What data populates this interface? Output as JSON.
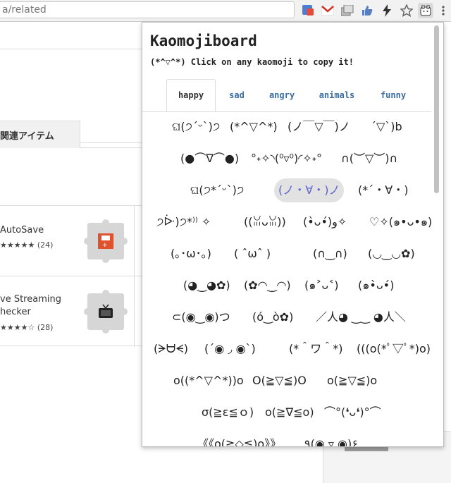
{
  "browser": {
    "url": "a/related"
  },
  "background": {
    "tab_label": "関連アイテム",
    "items": [
      {
        "name": "AutoSave",
        "rating": "★★★★★",
        "count": "(24)"
      },
      {
        "name": "ve Streaming\nhecker",
        "rating": "★★★★☆",
        "count": "(28)"
      }
    ]
  },
  "popup": {
    "title": "Kaomojiboard",
    "subtitle": "(*^▽^*) Click on any kaomoji to copy it!",
    "tabs": [
      "happy",
      "sad",
      "angry",
      "animals",
      "funny"
    ],
    "active_tab": "happy",
    "rows": [
      [
        "ଘ(੭ˊᵕˋ)੭",
        "(*^▽^*)",
        "(ノ￣▽￣)ノ",
        "´▽`)b"
      ],
      [
        "(●⌒∇⌒●)",
        "°˖✧◝(⁰▿⁰)◜✧˖°",
        "∩(︶▽︶)∩"
      ],
      [
        "ଘ(੭*ˊᵕˋ)੭",
        "(ノ・∀・)ノ",
        "(*´・∀・)"
      ],
      [
        "੭ᐕ)੭*⁾⁾ ✧",
        "((ꈍᴗꈍ))",
        "(•̀ᴗ•́)و✧",
        "♡✧(๑•ᴗ•๑)"
      ],
      [
        "(｡･ω･｡)",
        "( ˆωˆ )",
        "(∩‿∩)",
        "(◡‿◡✿)"
      ],
      [
        "(◕‿◕✿)",
        "(✿◠‿◠)",
        "(๑˃ᴗ˂)",
        "(๑•̀ᴗ•́)"
      ],
      [
        "⊂(◉‿◉)つ",
        "(ó‿ò✿)",
        "／人◕ ‿‿ ◕人＼"
      ],
      [
        "(ᗒᗨᗕ)",
        "(´◉ ◞ ◉`)",
        "(*＾ワ＾*)",
        "(((o(*ﾟ▽ﾟ*)o)))"
      ],
      [
        "o((*^▽^*))o",
        "O(≧▽≦)O",
        "o(≧▽≦)o"
      ],
      [
        "σ(≧ε≦ｏ)",
        "o(≧∇≦o)",
        "⌒°(❛ᴗ❛)°⌒"
      ],
      [
        "《《o(≧◇≦)o》》",
        "٩(◉ ▿ ◉)۶"
      ]
    ],
    "selected": "(ノ・∀・)ノ"
  },
  "colors": {
    "tab_link": "#3a6ea5",
    "selected_text": "#5b62d6",
    "selected_bg": "#e2e2e2"
  }
}
